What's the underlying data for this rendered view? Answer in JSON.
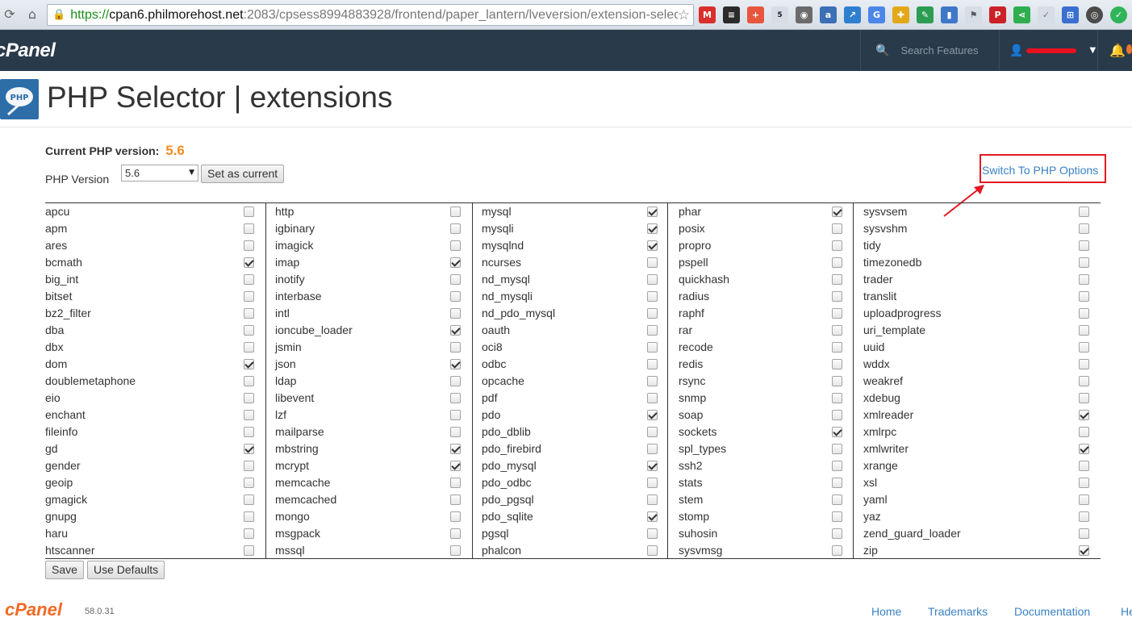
{
  "browser": {
    "url_scheme": "https://",
    "url_host": "cpan6.philmorehost.net",
    "url_rest": ":2083/cpsess8994883928/frontend/paper_lantern/lveversion/extension-selec"
  },
  "header": {
    "logo": "cPanel",
    "search_placeholder": "Search Features"
  },
  "page": {
    "title": "PHP Selector | extensions",
    "current_php_label": "Current PHP version:",
    "current_php_value": "5.6",
    "php_version_label": "PHP Version",
    "selected_version": "5.6",
    "set_current_label": "Set as current",
    "switch_link": "Switch To PHP Options",
    "save_label": "Save",
    "defaults_label": "Use Defaults"
  },
  "columns": [
    [
      {
        "name": "apcu",
        "checked": false
      },
      {
        "name": "apm",
        "checked": false
      },
      {
        "name": "ares",
        "checked": false
      },
      {
        "name": "bcmath",
        "checked": true
      },
      {
        "name": "big_int",
        "checked": false
      },
      {
        "name": "bitset",
        "checked": false
      },
      {
        "name": "bz2_filter",
        "checked": false
      },
      {
        "name": "dba",
        "checked": false
      },
      {
        "name": "dbx",
        "checked": false
      },
      {
        "name": "dom",
        "checked": true
      },
      {
        "name": "doublemetaphone",
        "checked": false
      },
      {
        "name": "eio",
        "checked": false
      },
      {
        "name": "enchant",
        "checked": false
      },
      {
        "name": "fileinfo",
        "checked": false
      },
      {
        "name": "gd",
        "checked": true
      },
      {
        "name": "gender",
        "checked": false
      },
      {
        "name": "geoip",
        "checked": false
      },
      {
        "name": "gmagick",
        "checked": false
      },
      {
        "name": "gnupg",
        "checked": false
      },
      {
        "name": "haru",
        "checked": false
      },
      {
        "name": "htscanner",
        "checked": false
      }
    ],
    [
      {
        "name": "http",
        "checked": false
      },
      {
        "name": "igbinary",
        "checked": false
      },
      {
        "name": "imagick",
        "checked": false
      },
      {
        "name": "imap",
        "checked": true
      },
      {
        "name": "inotify",
        "checked": false
      },
      {
        "name": "interbase",
        "checked": false
      },
      {
        "name": "intl",
        "checked": false
      },
      {
        "name": "ioncube_loader",
        "checked": true
      },
      {
        "name": "jsmin",
        "checked": false
      },
      {
        "name": "json",
        "checked": true
      },
      {
        "name": "ldap",
        "checked": false
      },
      {
        "name": "libevent",
        "checked": false
      },
      {
        "name": "lzf",
        "checked": false
      },
      {
        "name": "mailparse",
        "checked": false
      },
      {
        "name": "mbstring",
        "checked": true
      },
      {
        "name": "mcrypt",
        "checked": true
      },
      {
        "name": "memcache",
        "checked": false
      },
      {
        "name": "memcached",
        "checked": false
      },
      {
        "name": "mongo",
        "checked": false
      },
      {
        "name": "msgpack",
        "checked": false
      },
      {
        "name": "mssql",
        "checked": false
      }
    ],
    [
      {
        "name": "mysql",
        "checked": true
      },
      {
        "name": "mysqli",
        "checked": true
      },
      {
        "name": "mysqlnd",
        "checked": true
      },
      {
        "name": "ncurses",
        "checked": false
      },
      {
        "name": "nd_mysql",
        "checked": false
      },
      {
        "name": "nd_mysqli",
        "checked": false
      },
      {
        "name": "nd_pdo_mysql",
        "checked": false
      },
      {
        "name": "oauth",
        "checked": false
      },
      {
        "name": "oci8",
        "checked": false
      },
      {
        "name": "odbc",
        "checked": false
      },
      {
        "name": "opcache",
        "checked": false
      },
      {
        "name": "pdf",
        "checked": false
      },
      {
        "name": "pdo",
        "checked": true
      },
      {
        "name": "pdo_dblib",
        "checked": false
      },
      {
        "name": "pdo_firebird",
        "checked": false
      },
      {
        "name": "pdo_mysql",
        "checked": true
      },
      {
        "name": "pdo_odbc",
        "checked": false
      },
      {
        "name": "pdo_pgsql",
        "checked": false
      },
      {
        "name": "pdo_sqlite",
        "checked": true
      },
      {
        "name": "pgsql",
        "checked": false
      },
      {
        "name": "phalcon",
        "checked": false
      }
    ],
    [
      {
        "name": "phar",
        "checked": true
      },
      {
        "name": "posix",
        "checked": false
      },
      {
        "name": "propro",
        "checked": false
      },
      {
        "name": "pspell",
        "checked": false
      },
      {
        "name": "quickhash",
        "checked": false
      },
      {
        "name": "radius",
        "checked": false
      },
      {
        "name": "raphf",
        "checked": false
      },
      {
        "name": "rar",
        "checked": false
      },
      {
        "name": "recode",
        "checked": false
      },
      {
        "name": "redis",
        "checked": false
      },
      {
        "name": "rsync",
        "checked": false
      },
      {
        "name": "snmp",
        "checked": false
      },
      {
        "name": "soap",
        "checked": false
      },
      {
        "name": "sockets",
        "checked": true
      },
      {
        "name": "spl_types",
        "checked": false
      },
      {
        "name": "ssh2",
        "checked": false
      },
      {
        "name": "stats",
        "checked": false
      },
      {
        "name": "stem",
        "checked": false
      },
      {
        "name": "stomp",
        "checked": false
      },
      {
        "name": "suhosin",
        "checked": false
      },
      {
        "name": "sysvmsg",
        "checked": false
      }
    ],
    [
      {
        "name": "sysvsem",
        "checked": false
      },
      {
        "name": "sysvshm",
        "checked": false
      },
      {
        "name": "tidy",
        "checked": false
      },
      {
        "name": "timezonedb",
        "checked": false
      },
      {
        "name": "trader",
        "checked": false
      },
      {
        "name": "translit",
        "checked": false
      },
      {
        "name": "uploadprogress",
        "checked": false
      },
      {
        "name": "uri_template",
        "checked": false
      },
      {
        "name": "uuid",
        "checked": false
      },
      {
        "name": "wddx",
        "checked": false
      },
      {
        "name": "weakref",
        "checked": false
      },
      {
        "name": "xdebug",
        "checked": false
      },
      {
        "name": "xmlreader",
        "checked": true
      },
      {
        "name": "xmlrpc",
        "checked": false
      },
      {
        "name": "xmlwriter",
        "checked": true
      },
      {
        "name": "xrange",
        "checked": false
      },
      {
        "name": "xsl",
        "checked": false
      },
      {
        "name": "yaml",
        "checked": false
      },
      {
        "name": "yaz",
        "checked": false
      },
      {
        "name": "zend_guard_loader",
        "checked": false
      },
      {
        "name": "zip",
        "checked": true
      }
    ]
  ],
  "footer": {
    "logo": "cPanel",
    "version": "58.0.31",
    "links": [
      "Home",
      "Trademarks",
      "Documentation",
      "He"
    ]
  },
  "colors": {
    "header_bg": "#293a4a",
    "accent_orange": "#f68c1f",
    "link_blue": "#3a82c4",
    "highlight_red": "#e11a22"
  }
}
